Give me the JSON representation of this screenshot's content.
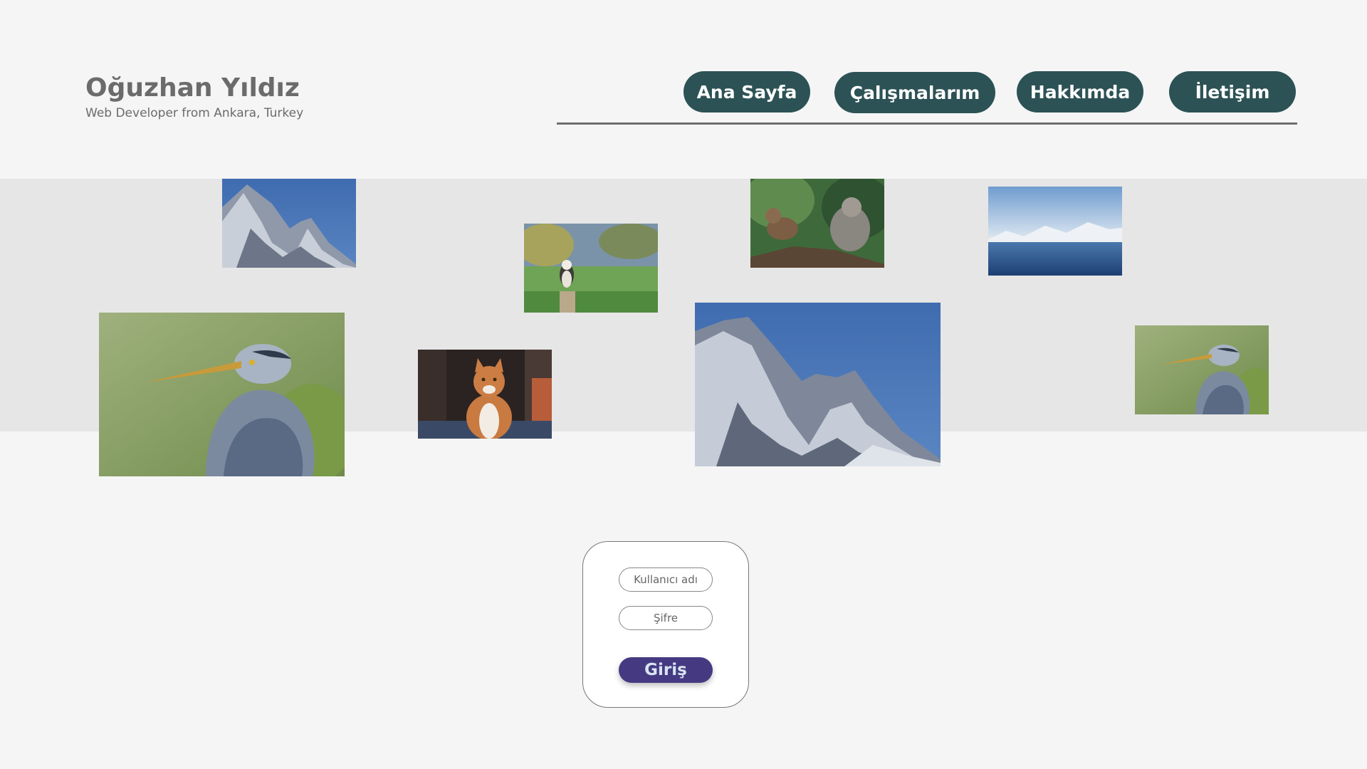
{
  "header": {
    "name": "Oğuzhan Yıldız",
    "tagline": "Web Developer from Ankara, Turkey"
  },
  "nav": {
    "items": [
      {
        "label": "Ana Sayfa"
      },
      {
        "label": "Çalışmalarım"
      },
      {
        "label": "Hakkımda"
      },
      {
        "label": "İletişim"
      }
    ]
  },
  "gallery": {
    "photos": [
      {
        "subject": "mountain-peak"
      },
      {
        "subject": "kookaburra-bird"
      },
      {
        "subject": "monkeys"
      },
      {
        "subject": "glacier-lake"
      },
      {
        "subject": "heron"
      },
      {
        "subject": "cat"
      },
      {
        "subject": "mountain-peak"
      },
      {
        "subject": "heron"
      }
    ]
  },
  "login": {
    "username_placeholder": "Kullanıcı adı",
    "password_placeholder": "Şifre",
    "submit_label": "Giriş"
  },
  "colors": {
    "nav_button": "#2c5255",
    "login_button": "#453a82",
    "background": "#f5f5f5",
    "gallery_band": "#e6e6e6"
  }
}
